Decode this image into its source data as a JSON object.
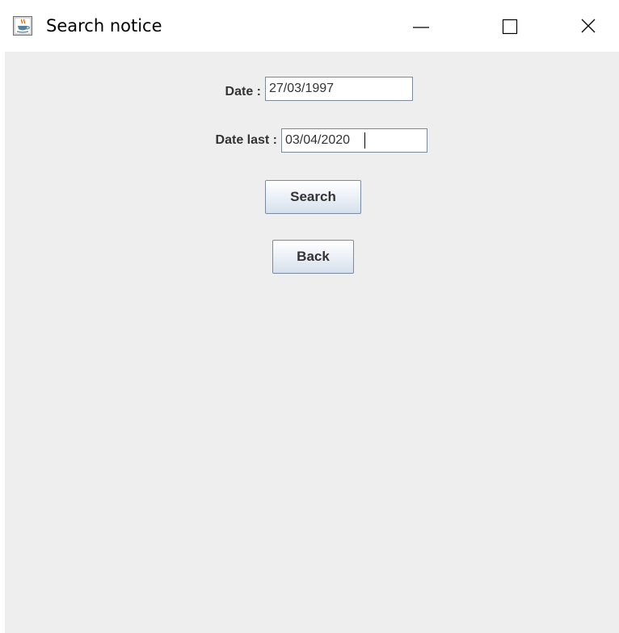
{
  "window": {
    "title": "Search notice",
    "app_icon": "java-coffee-icon",
    "controls": {
      "minimize_icon": "minimize-icon",
      "maximize_icon": "maximize-icon",
      "close_icon": "close-icon"
    }
  },
  "form": {
    "date_label": "Date :",
    "date_value": "27/03/1997",
    "date_last_label": "Date last :",
    "date_last_value": "03/04/2020",
    "search_label": "Search",
    "back_label": "Back"
  },
  "colors": {
    "panel_background": "#eeeeee",
    "label_text": "#333333",
    "field_border": "#7a8a9a",
    "button_border": "#7a8aa0"
  }
}
